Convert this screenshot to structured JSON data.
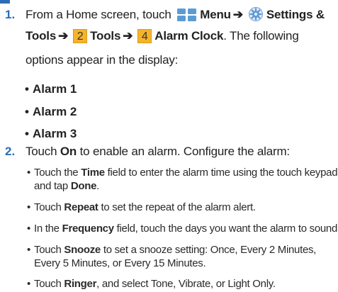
{
  "step1": {
    "number": "1.",
    "prefix": "From a Home screen, touch",
    "menu_label": "Menu",
    "settings_label": "Settings &",
    "tools_suffix": "Tools",
    "box2": "2",
    "tools_label": "Tools",
    "box4": "4",
    "alarm_clock_label": "Alarm Clock",
    "following": ". The following",
    "line3": "options appear in the display:",
    "options": [
      "Alarm 1",
      "Alarm 2",
      "Alarm 3"
    ]
  },
  "step2": {
    "number": "2.",
    "touch": "Touch",
    "on_label": "On",
    "rest": "to enable an alarm. Configure the alarm:",
    "items": {
      "time_a": "Touch the",
      "time_b": "Time",
      "time_c": "field to enter the alarm time using the touch keypad",
      "time_d": "and tap",
      "time_e": "Done",
      "time_f": ".",
      "repeat_a": "Touch",
      "repeat_b": "Repeat",
      "repeat_c": "to set the repeat of the alarm alert.",
      "freq_a": "In the",
      "freq_b": "Frequency",
      "freq_c": "field, touch the days you want the alarm to sound.",
      "snooze_a": "Touch",
      "snooze_b": "Snooze",
      "snooze_c": "to set a snooze setting: Once, Every 2 Minutes,",
      "snooze_d": "Every 5 Minutes, or Every 15 Minutes.",
      "ringer_a": "Touch",
      "ringer_b": "Ringer",
      "ringer_c": ", and select Tone, Vibrate, or Light Only."
    }
  },
  "colors": {
    "accent": "#2d6db5",
    "box": "#f5b32a",
    "icon": "#5b9bd5"
  }
}
